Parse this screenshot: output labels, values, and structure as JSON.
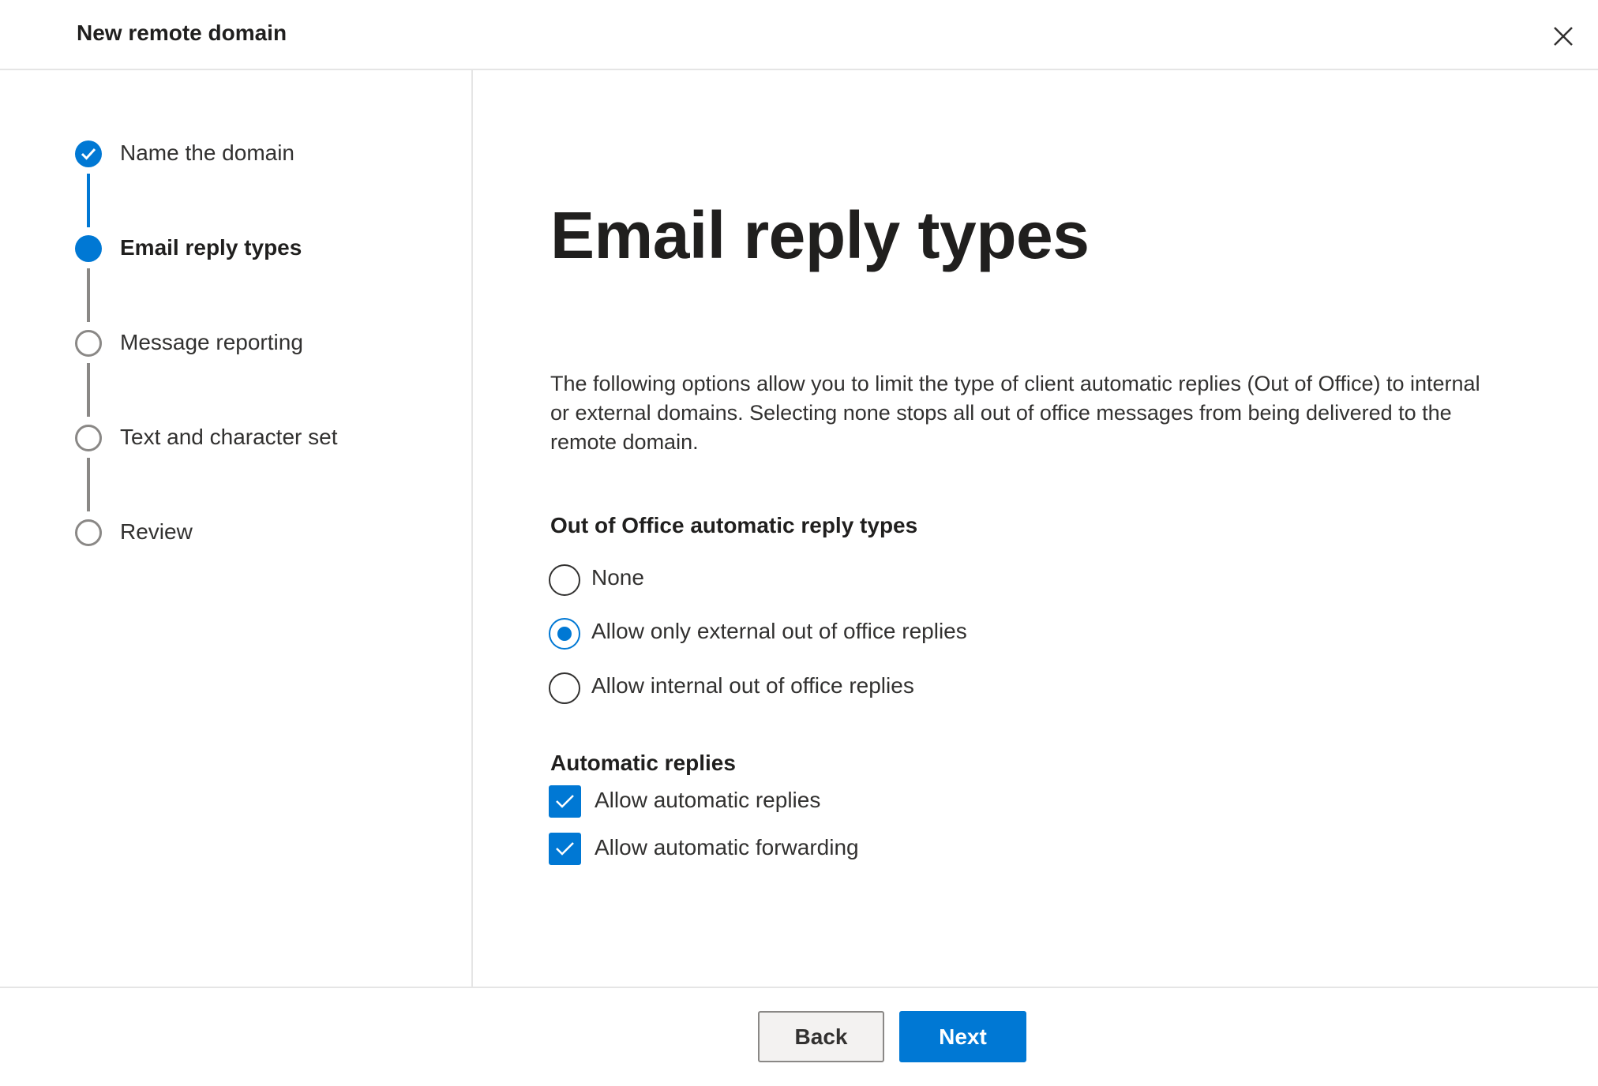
{
  "header": {
    "title": "New remote domain",
    "close_icon": "close-icon"
  },
  "stepper": {
    "steps": [
      {
        "label": "Name the domain",
        "state": "completed"
      },
      {
        "label": "Email reply types",
        "state": "current"
      },
      {
        "label": "Message reporting",
        "state": "pending"
      },
      {
        "label": "Text and character set",
        "state": "pending"
      },
      {
        "label": "Review",
        "state": "pending"
      }
    ]
  },
  "main": {
    "title": "Email reply types",
    "description": "The following options allow you to limit the type of client automatic replies (Out of Office) to internal or external domains. Selecting none stops all out of office messages from being delivered to the remote domain.",
    "ooo_section": {
      "title": "Out of Office automatic reply types",
      "options": [
        {
          "label": "None",
          "selected": false
        },
        {
          "label": "Allow only external out of office replies",
          "selected": true
        },
        {
          "label": "Allow internal out of office replies",
          "selected": false
        }
      ]
    },
    "auto_section": {
      "title": "Automatic replies",
      "checkboxes": [
        {
          "label": "Allow automatic replies",
          "checked": true
        },
        {
          "label": "Allow automatic forwarding",
          "checked": true
        }
      ]
    }
  },
  "footer": {
    "back_label": "Back",
    "next_label": "Next"
  },
  "colors": {
    "accent": "#0078d4",
    "text": "#323130",
    "border": "#8a8886"
  }
}
